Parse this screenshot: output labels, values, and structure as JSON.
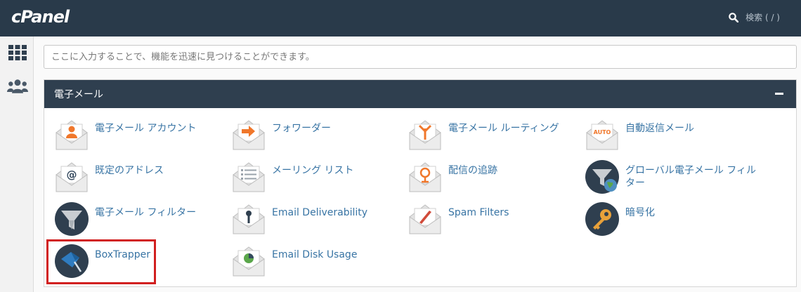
{
  "app": {
    "logo": "cPanel"
  },
  "header": {
    "search_hint": "検索 ( / )"
  },
  "feature_search": {
    "placeholder": "ここに入力することで、機能を迅速に見つけることができます。"
  },
  "section": {
    "title": "電子メール",
    "items": [
      {
        "label": "電子メール アカウント",
        "icon": "email-accounts-icon"
      },
      {
        "label": "フォワーダー",
        "icon": "forwarders-icon"
      },
      {
        "label": "電子メール ルーティング",
        "icon": "email-routing-icon"
      },
      {
        "label": "自動返信メール",
        "icon": "autoresponders-icon"
      },
      {
        "label": "既定のアドレス",
        "icon": "default-address-icon"
      },
      {
        "label": "メーリング リスト",
        "icon": "mailing-lists-icon"
      },
      {
        "label": "配信の追跡",
        "icon": "track-delivery-icon"
      },
      {
        "label": "グローバル電子メール フィルター",
        "icon": "global-email-filters-icon"
      },
      {
        "label": "電子メール フィルター",
        "icon": "email-filters-icon"
      },
      {
        "label": "Email Deliverability",
        "icon": "email-deliverability-icon"
      },
      {
        "label": "Spam Filters",
        "icon": "spam-filters-icon"
      },
      {
        "label": "暗号化",
        "icon": "encryption-icon"
      },
      {
        "label": "BoxTrapper",
        "icon": "boxtrapper-icon"
      },
      {
        "label": "Email Disk Usage",
        "icon": "email-disk-usage-icon"
      }
    ],
    "auto_badge": "AUTO"
  },
  "colors": {
    "topbar": "#293a4a",
    "panel_header": "#2f3f4f",
    "link": "#3874a4",
    "accent_orange": "#f0772b",
    "highlight": "#d11f1f"
  }
}
